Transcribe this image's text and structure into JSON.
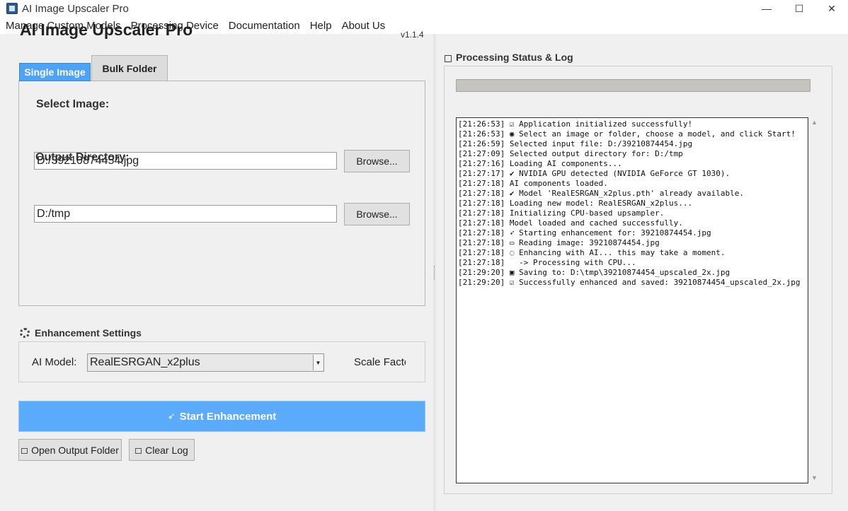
{
  "window": {
    "title": "AI Image Upscaler Pro",
    "minimize": "—",
    "maximize": "☐",
    "close": "✕"
  },
  "menu": {
    "items": [
      "Manage Custom Models",
      "Processing Device",
      "Documentation",
      "Help",
      "About Us"
    ]
  },
  "header": {
    "title": "AI Image Upscaler Pro",
    "version": "v1.1.4"
  },
  "tabs": {
    "single": "Single Image",
    "bulk": "Bulk Folder",
    "active": "single"
  },
  "single_image": {
    "select_label": "Select Image:",
    "image_path": "D:/39210874454.jpg",
    "browse_label": "Browse...",
    "output_label": "Output Directory:",
    "output_path": "D:/tmp",
    "browse_output_label": "Browse..."
  },
  "settings": {
    "heading": "Enhancement Settings",
    "model_label": "AI Model:",
    "model_value": "RealESRGAN_x2plus",
    "scale_label": "Scale Factor"
  },
  "actions": {
    "start_label": "Start Enhancement",
    "open_folder_label": "Open Output Folder",
    "clear_log_label": "Clear Log"
  },
  "status": {
    "heading": "Processing Status & Log",
    "progress": 0,
    "log": [
      "[21:26:53] ☑ Application initialized successfully!",
      "[21:26:53] ◉ Select an image or folder, choose a model, and click Start!",
      "[21:26:59] Selected input file: D:/39210874454.jpg",
      "[21:27:09] Selected output directory for: D:/tmp",
      "[21:27:16] Loading AI components...",
      "[21:27:17] ✔ NVIDIA GPU detected (NVIDIA GeForce GT 1030).",
      "[21:27:18] AI components loaded.",
      "[21:27:18] ✔ Model 'RealESRGAN_x2plus.pth' already available.",
      "[21:27:18] Loading new model: RealESRGAN_x2plus...",
      "[21:27:18] Initializing CPU-based upsampler.",
      "[21:27:18] Model loaded and cached successfully.",
      "[21:27:18] ➶ Starting enhancement for: 39210874454.jpg",
      "[21:27:18] ▭ Reading image: 39210874454.jpg",
      "[21:27:18] ◌ Enhancing with AI... this may take a moment.",
      "[21:27:18]   -> Processing with CPU...",
      "[21:29:20] ▣ Saving to: D:\\tmp\\39210874454_upscaled_2x.jpg",
      "[21:29:20] ☑ Successfully enhanced and saved: 39210874454_upscaled_2x.jpg"
    ]
  },
  "colors": {
    "accent": "#5aabfb",
    "tab_active": "#4ea3f7",
    "progress_track": "#c6c4bf"
  }
}
